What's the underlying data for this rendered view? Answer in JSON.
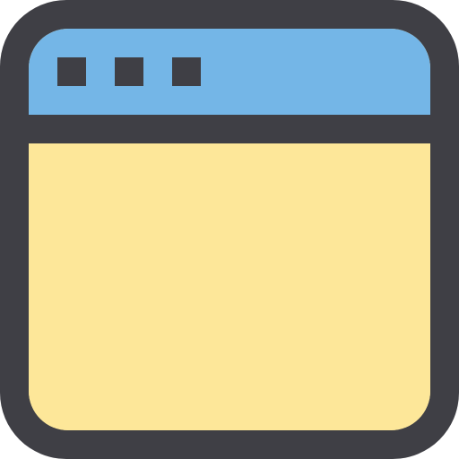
{
  "icon": {
    "name": "browser-window-icon",
    "colors": {
      "frame": "#3f3f45",
      "title_bar": "#74b6e7",
      "content": "#fde799",
      "dots": "#3f3f45"
    },
    "title_bar_dots": 3
  }
}
